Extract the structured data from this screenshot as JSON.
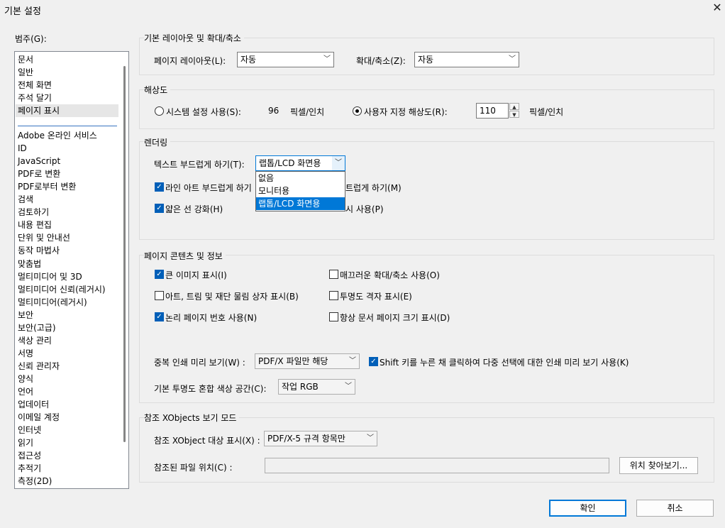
{
  "window": {
    "title": "기본 설정",
    "close": "✕"
  },
  "category": {
    "label": "범주(G):",
    "items_top": [
      "문서",
      "일반",
      "전체 화면",
      "주석 달기",
      "페이지 표시"
    ],
    "items": [
      "Adobe 온라인 서비스",
      "ID",
      "JavaScript",
      "PDF로 변환",
      "PDF로부터 변환",
      "검색",
      "검토하기",
      "내용 편집",
      "단위 및 안내선",
      "동작 마법사",
      "맞춤법",
      "멀티미디어 및 3D",
      "멀티미디어 신뢰(레거시)",
      "멀티미디어(레거시)",
      "보안",
      "보안(고급)",
      "색상 관리",
      "서명",
      "신뢰 관리자",
      "양식",
      "언어",
      "업데이터",
      "이메일 계정",
      "인터넷",
      "읽기",
      "접근성",
      "추적기",
      "측정(2D)"
    ]
  },
  "layout": {
    "title": "기본 레이아웃 및 확대/축소",
    "page_layout_label": "페이지 레이아웃(L):",
    "page_layout_value": "자동",
    "zoom_label": "확대/축소(Z):",
    "zoom_value": "자동"
  },
  "resolution": {
    "title": "해상도",
    "system_label": "시스템 설정 사용(S):",
    "system_value": "96",
    "system_unit": "픽셀/인치",
    "custom_label": "사용자 지정 해상도(R):",
    "custom_value": "110",
    "custom_unit": "픽셀/인치"
  },
  "rendering": {
    "title": "렌더링",
    "smooth_text_label": "텍스트 부드럽게 하기(T):",
    "smooth_text_value": "랩톱/LCD 화면용",
    "options": [
      "없음",
      "모니터용",
      "랩톱/LCD 화면용"
    ],
    "smooth_lineart_label": "라인 아트 부드럽게 하기",
    "smooth_images_partial": "트럽게 하기(M)",
    "thin_lines_label": "얇은 선 강화(H)",
    "cache_partial": "시 사용(P)"
  },
  "content": {
    "title": "페이지 콘텐츠 및 정보",
    "large_images": "큰 이미지 표시(I)",
    "smooth_zoom": "매끄러운 확대/축소 사용(O)",
    "art_trim": "아트, 트림 및 재단 물림 상자 표시(B)",
    "transparency_grid": "투명도 격자 표시(E)",
    "logical_page": "논리 페이지 번호 사용(N)",
    "doc_page_size": "항상 문서 페이지 크기 표시(D)",
    "overprint_label": "중복 인쇄 미리 보기(W) :",
    "overprint_value": "PDF/X 파일만 해당",
    "shift_click": "Shift 키를 누른 채 클릭하여 다중 선택에 대한 인쇄 미리 보기 사용(K)",
    "blend_label": "기본 투명도 혼합 색상 공간(C):",
    "blend_value": "작업 RGB"
  },
  "xobjects": {
    "title": "참조 XObjects 보기 모드",
    "target_label": "참조 XObject 대상 표시(X) :",
    "target_value": "PDF/X-5 규격 항목만",
    "file_location_label": "참조된 파일 위치(C) :",
    "browse": "위치 찾아보기..."
  },
  "buttons": {
    "ok": "확인",
    "cancel": "취소"
  }
}
